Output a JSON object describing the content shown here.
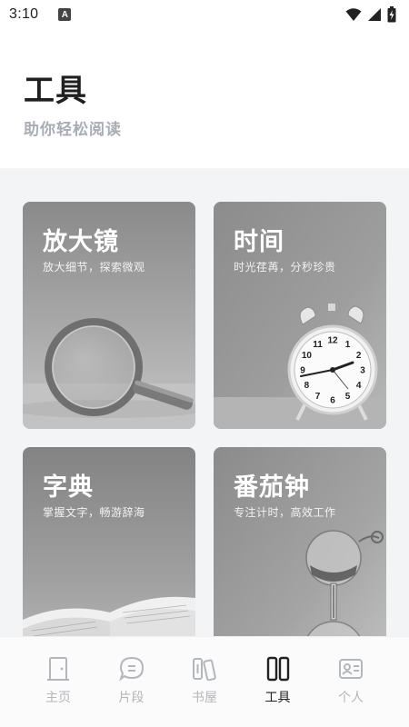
{
  "status_bar": {
    "time": "3:10",
    "notification_badge": "A"
  },
  "header": {
    "title": "工具",
    "subtitle": "助你轻松阅读"
  },
  "tools": [
    {
      "title": "放大镜",
      "description": "放大细节，探索微观",
      "icon": "magnifier-image"
    },
    {
      "title": "时间",
      "description": "时光荏苒，分秒珍贵",
      "icon": "alarm-clock-image"
    },
    {
      "title": "字典",
      "description": "掌握文字，畅游辞海",
      "icon": "book-image"
    },
    {
      "title": "番茄钟",
      "description": "专注计时，高效工作",
      "icon": "hourglass-image"
    }
  ],
  "clock_numbers": [
    "12",
    "1",
    "2",
    "3",
    "4",
    "5",
    "6",
    "7",
    "8",
    "9",
    "10",
    "11"
  ],
  "bottom_nav": [
    {
      "label": "主页",
      "icon": "door-icon",
      "active": false
    },
    {
      "label": "片段",
      "icon": "chat-bubble-icon",
      "active": false
    },
    {
      "label": "书屋",
      "icon": "books-icon",
      "active": false
    },
    {
      "label": "工具",
      "icon": "tools-icon",
      "active": true
    },
    {
      "label": "个人",
      "icon": "id-card-icon",
      "active": false
    }
  ],
  "colors": {
    "active_nav": "#222222",
    "inactive_nav": "#b3b6bb",
    "subtitle": "#a8adb5",
    "content_bg": "#f3f4f6"
  }
}
